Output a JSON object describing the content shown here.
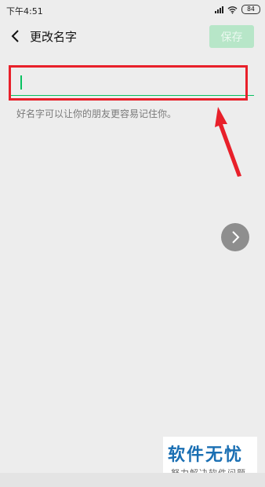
{
  "status_bar": {
    "time": "下午4:51",
    "battery": "84",
    "icons": [
      "signal-icon",
      "wifi-icon",
      "battery-icon"
    ]
  },
  "nav": {
    "back_icon": "chevron-left-icon",
    "title": "更改名字",
    "save_label": "保存"
  },
  "form": {
    "name_value": "",
    "hint": "好名字可以让你的朋友更容易记住你。"
  },
  "floating": {
    "next_icon": "chevron-right-icon"
  },
  "watermark": {
    "title": "软件无忧",
    "subtitle": "努力解决软件问题"
  },
  "colors": {
    "accent": "#07c160",
    "save_disabled_bg": "#b7e6c8",
    "annotation_red": "#e8202a",
    "background": "#ededed",
    "watermark_blue": "#1a6fb3"
  }
}
